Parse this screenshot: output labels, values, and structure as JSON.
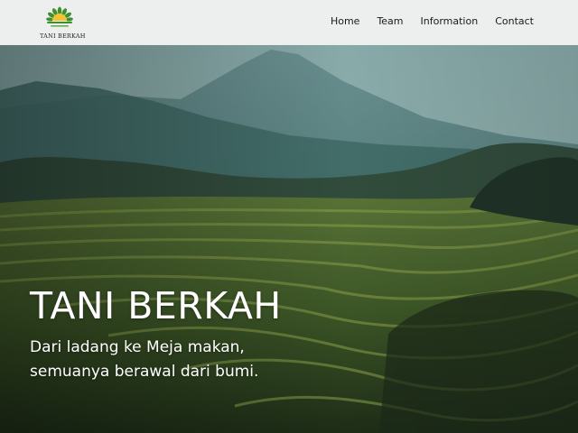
{
  "brand": {
    "name": "TANI BERKAH",
    "logo_icon": "rising-sun-leaf-icon",
    "color": "#3f8f2e"
  },
  "nav": {
    "items": [
      {
        "label": "Home"
      },
      {
        "label": "Team"
      },
      {
        "label": "Information"
      },
      {
        "label": "Contact"
      }
    ]
  },
  "hero": {
    "title": "TANI BERKAH",
    "subtitle_line1": "Dari ladang ke Meja makan,",
    "subtitle_line2": "semuanya berawal dari bumi.",
    "background": "rice-terrace-mountain-photo"
  }
}
